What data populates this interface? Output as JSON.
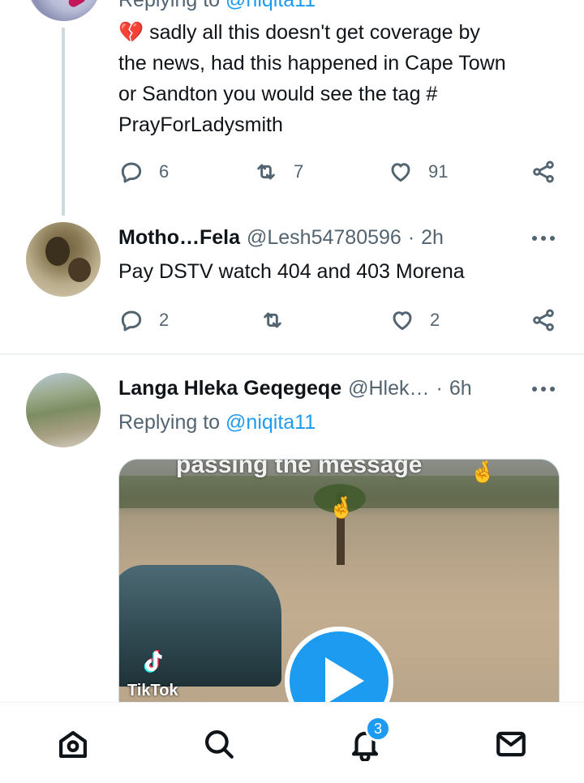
{
  "tweet_top": {
    "replying_prefix": "Replying to",
    "replying_handle": "@niqita11",
    "emoji": "💔",
    "text_lines": [
      "sadly all this doesn't get coverage by",
      "the news, had this happened in Cape Town",
      "or Sandton you would see the tag #",
      "PrayForLadysmith"
    ],
    "replies": "6",
    "retweets": "7",
    "likes": "91"
  },
  "tweet_mid": {
    "display_name": "Motho…Fela",
    "handle": "@Lesh54780596",
    "separator": "·",
    "time": "2h",
    "text": "Pay DSTV watch 404 and 403 Morena",
    "replies": "2",
    "retweets": "",
    "likes": "2"
  },
  "tweet_bot": {
    "display_name": "Langa Hleka Geqegeqe",
    "handle": "@Hlek…",
    "separator": "·",
    "time": "6h",
    "replying_prefix": "Replying to",
    "replying_handle": "@niqita11",
    "media": {
      "caption": "passing the message",
      "watermark": "TikTok"
    }
  },
  "bottom_nav": {
    "items": [
      "home-icon",
      "search-icon",
      "bell-icon",
      "mail-icon"
    ],
    "notification_count": "3"
  },
  "colors": {
    "accent": "#1d9bf0",
    "text": "#0f1419",
    "secondary": "#536471"
  }
}
